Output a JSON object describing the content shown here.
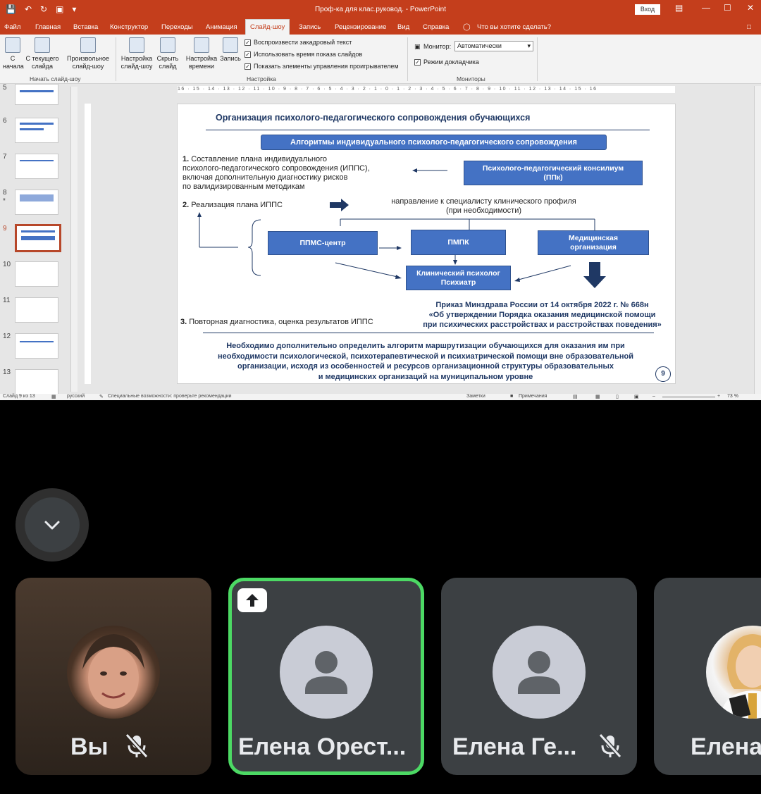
{
  "ppt": {
    "window_title": "Проф-ка для клас.руковод.  -  PowerPoint",
    "login_label": "Вход",
    "tabs": [
      "Файл",
      "Главная",
      "Вставка",
      "Конструктор",
      "Переходы",
      "Анимация",
      "Слайд-шоу",
      "Запись",
      "Рецензирование",
      "Вид",
      "Справка"
    ],
    "tell_me": "Что вы хотите сделать?",
    "ribbon": {
      "from_start": "С начала",
      "from_current": "С текущего слайда",
      "custom": "Произвольное слайд-шоу",
      "group_start": "Начать слайд-шоу",
      "setup": "Настройка слайд-шоу",
      "hide": "Скрыть слайд",
      "timings": "Настройка времени",
      "record": "Запись",
      "chk_narration": "Воспроизвести закадровый текст",
      "chk_timings": "Использовать время показа слайдов",
      "chk_controls": "Показать элементы управления проигрывателем",
      "group_setup": "Настройка",
      "monitor_label": "Монитор:",
      "monitor_value": "Автоматически",
      "presenter_view": "Режим докладчика",
      "group_monitors": "Мониторы"
    },
    "slide_numbers": [
      "5",
      "6",
      "7",
      "8",
      "9",
      "10",
      "11",
      "12",
      "13"
    ],
    "hruler_text": "16 · 15 · 14 · 13 · 12 · 11 · 10 · 9 · 8 · 7 · 6 · 5 · 4 · 3 · 2 · 1 · 0 · 1 · 2 · 3 · 4 · 5 · 6 · 7 · 8 · 9 · 10 · 11 · 12 · 13 · 14 · 15 · 16",
    "status": {
      "slide_of": "Слайд 9 из 13",
      "language": "русский",
      "accessibility": "Специальные возможности: проверьте рекомендации",
      "notes": "Заметки",
      "comments": "Примечания",
      "zoom": "73 %"
    }
  },
  "slide": {
    "title": "Организация психолого-педагогического сопровождения обучающихся",
    "header": "Алгоритмы индивидуального психолого-педагогического сопровождения",
    "step1_num": "1.",
    "step1_lines": [
      "Составление плана индивидуального",
      "психолого-педагогического сопровождения (ИППС),",
      "включая дополнительную диагностику рисков",
      "по валидизированным методикам"
    ],
    "ppk_lines": [
      "Психолого-педагогический консилиум",
      "(ППк)"
    ],
    "step2_num": "2.",
    "step2_text": "Реализация плана ИППС",
    "direction_lines": [
      "направление к специалисту клинического профиля",
      "(при необходимости)"
    ],
    "box_ppms": "ППМС-центр",
    "box_pmpk": "ПМПК",
    "box_med_lines": [
      "Медицинская",
      "организация"
    ],
    "box_clin_lines": [
      "Клинический психолог",
      "Психиатр"
    ],
    "order_lines": [
      "Приказ Минздрава России от 14 октября 2022 г. № 668н",
      "«Об утверждении Порядка оказания медицинской помощи",
      "при психических расстройствах и расстройствах поведения»"
    ],
    "step3_num": "3.",
    "step3_text": "Повторная диагностика, оценка результатов ИППС",
    "conclusion_lines": [
      "Необходимо дополнительно определить алгоритм маршрутизации обучающихся для оказания им при",
      "необходимости психологической, психотерапевтической и психиатрической помощи вне образовательной",
      "организации, исходя из особенностей и ресурсов организационной структуры образовательных",
      "и медицинских организаций на муниципальном уровне"
    ],
    "page_number": "9"
  },
  "meeting": {
    "participants": [
      {
        "name": "Вы",
        "muted": true,
        "speaking": false
      },
      {
        "name": "Елена Орест...",
        "muted": false,
        "speaking": true
      },
      {
        "name": "Елена Ге...",
        "muted": true,
        "speaking": false
      },
      {
        "name": "Елена",
        "muted": false,
        "speaking": false
      }
    ]
  }
}
